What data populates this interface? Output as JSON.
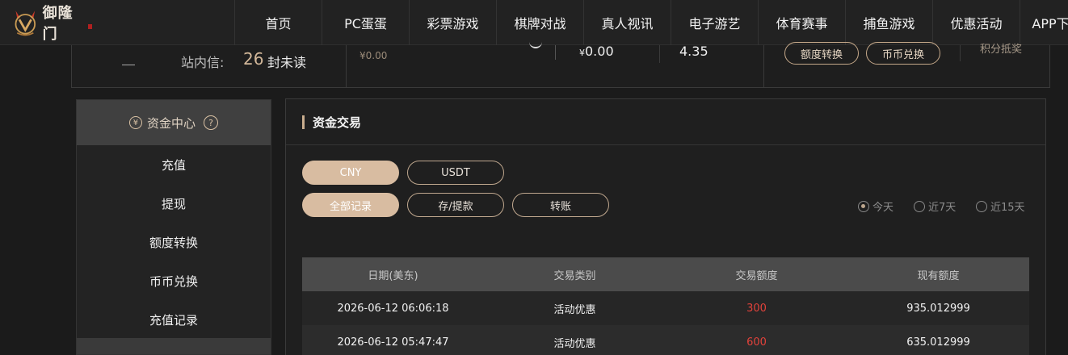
{
  "brand": {
    "name": "御隆门"
  },
  "nav": {
    "items": [
      {
        "label": "首页",
        "width": 108
      },
      {
        "label": "PC蛋蛋",
        "width": 108
      },
      {
        "label": "彩票游戏",
        "width": 108
      },
      {
        "label": "棋牌对战",
        "width": 108
      },
      {
        "label": "真人视讯",
        "width": 108
      },
      {
        "label": "电子游艺",
        "width": 108
      },
      {
        "label": "体育赛事",
        "width": 108
      },
      {
        "label": "捕鱼游戏",
        "width": 108
      },
      {
        "label": "优惠活动",
        "width": 108
      },
      {
        "label": "APP下",
        "width": 76
      }
    ]
  },
  "account": {
    "messages_label": "站内信:",
    "messages_count": "26",
    "messages_unit": "封未读",
    "balance_small": "¥0.00",
    "value_a": "0.00",
    "value_a_prefix": "¥",
    "value_b": "4.35",
    "quota_transfer": "额度转换",
    "coin_exchange": "币币兑换",
    "points_text": "积分抵奖"
  },
  "sidebar": {
    "title": "资金中心",
    "items": [
      "充值",
      "提现",
      "额度转换",
      "币币兑换",
      "充值记录"
    ]
  },
  "panel": {
    "title": "资金交易",
    "currency_tabs": [
      "CNY",
      "USDT"
    ],
    "record_tabs": [
      "全部记录",
      "存/提款",
      "转账"
    ],
    "date_filters": [
      "今天",
      "近7天",
      "近15天"
    ],
    "selected_date_filter": "今天"
  },
  "table": {
    "headers": [
      "日期(美东)",
      "交易类别",
      "交易额度",
      "现有额度"
    ],
    "rows": [
      [
        "2026-06-12 06:06:18",
        "活动优惠",
        "300",
        "935.012999"
      ],
      [
        "2026-06-12 05:47:47",
        "活动优惠",
        "600",
        "635.012999"
      ]
    ]
  },
  "colors": {
    "accent": "#d8bca1",
    "amount_red": "#e2423b",
    "background": "#1b1b1b"
  }
}
